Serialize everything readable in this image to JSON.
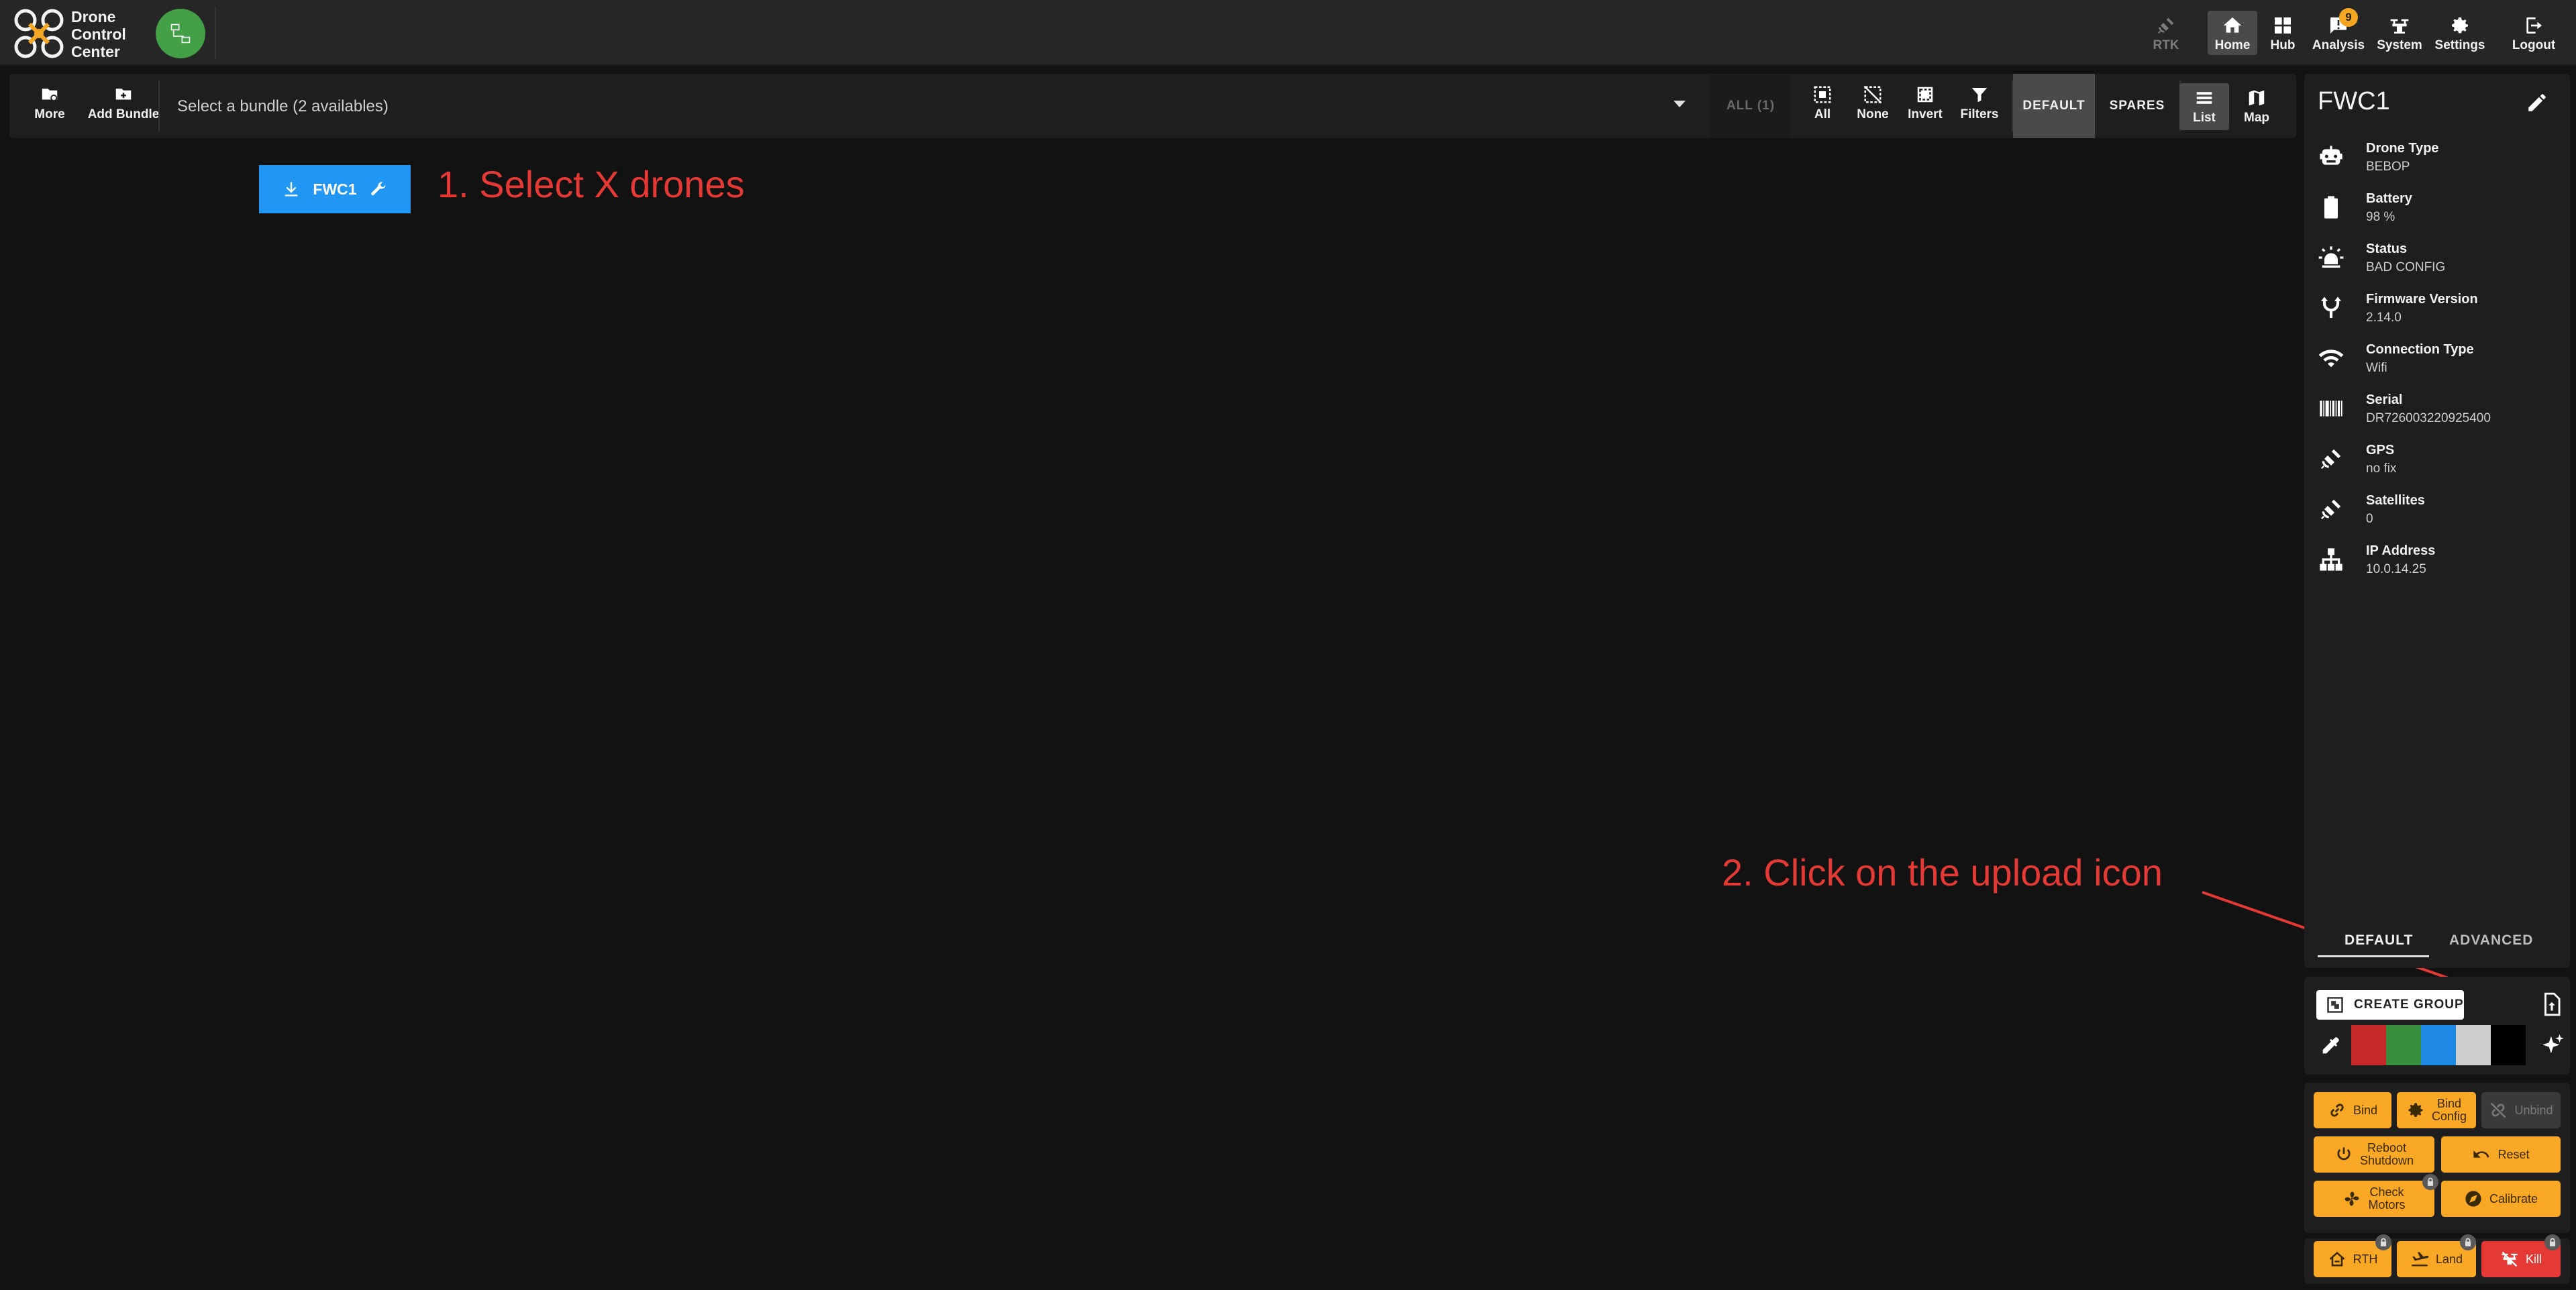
{
  "app": {
    "brand_line1": "Drone",
    "brand_line2": "Control",
    "brand_line3": "Center",
    "icon": "drone-logo-icon",
    "connection_icon": "network-icon",
    "connection_color": "#43a047"
  },
  "nav": {
    "rtk": "RTK",
    "home": "Home",
    "hub": "Hub",
    "analysis": "Analysis",
    "analysis_badge": "9",
    "system": "System",
    "settings": "Settings",
    "logout": "Logout"
  },
  "toolbar": {
    "more": "More",
    "add_bundle": "Add Bundle",
    "bundle_placeholder": "Select a bundle (2 availables)",
    "all_count": "ALL (1)",
    "select_all": "All",
    "select_none": "None",
    "invert": "Invert",
    "filters": "Filters",
    "default_tab": "DEFAULT",
    "spares_tab": "SPARES",
    "list_view": "List",
    "map_view": "Map"
  },
  "drone": {
    "name": "FWC1",
    "chip_color": "#2196f3"
  },
  "annotations": {
    "step1": "1. Select X drones",
    "step2": "2. Click on the upload icon",
    "color": "#e53935"
  },
  "panel": {
    "title": "FWC1",
    "properties": [
      {
        "label": "Drone Type",
        "value": "BEBOP",
        "icon": "robot-icon"
      },
      {
        "label": "Battery",
        "value": "98 %",
        "icon": "battery-icon"
      },
      {
        "label": "Status",
        "value": "BAD CONFIG",
        "icon": "alarm-light-icon"
      },
      {
        "label": "Firmware Version",
        "value": "2.14.0",
        "icon": "merge-icon"
      },
      {
        "label": "Connection Type",
        "value": "Wifi",
        "icon": "wifi-icon"
      },
      {
        "label": "Serial",
        "value": "DR726003220925400",
        "icon": "barcode-icon"
      },
      {
        "label": "GPS",
        "value": "no fix",
        "icon": "satellite-icon"
      },
      {
        "label": "Satellites",
        "value": "0",
        "icon": "satellite-icon"
      },
      {
        "label": "IP Address",
        "value": "10.0.14.25",
        "icon": "sitemap-icon"
      }
    ],
    "tab_default": "DEFAULT",
    "tab_advanced": "ADVANCED"
  },
  "group": {
    "create_label": "CREATE GROUP",
    "swatches": [
      "#c62828",
      "#388e3c",
      "#1e88e5",
      "#cfcfcf",
      "#000000"
    ]
  },
  "actions": {
    "bind": "Bind",
    "bind_config_1": "Bind",
    "bind_config_2": "Config",
    "unbind": "Unbind",
    "reboot_1": "Reboot",
    "reboot_2": "Shutdown",
    "reset": "Reset",
    "check_motors_1": "Check",
    "check_motors_2": "Motors",
    "calibrate": "Calibrate",
    "rth": "RTH",
    "land": "Land",
    "kill": "Kill",
    "accent": "#f9a825",
    "danger": "#e53935"
  }
}
